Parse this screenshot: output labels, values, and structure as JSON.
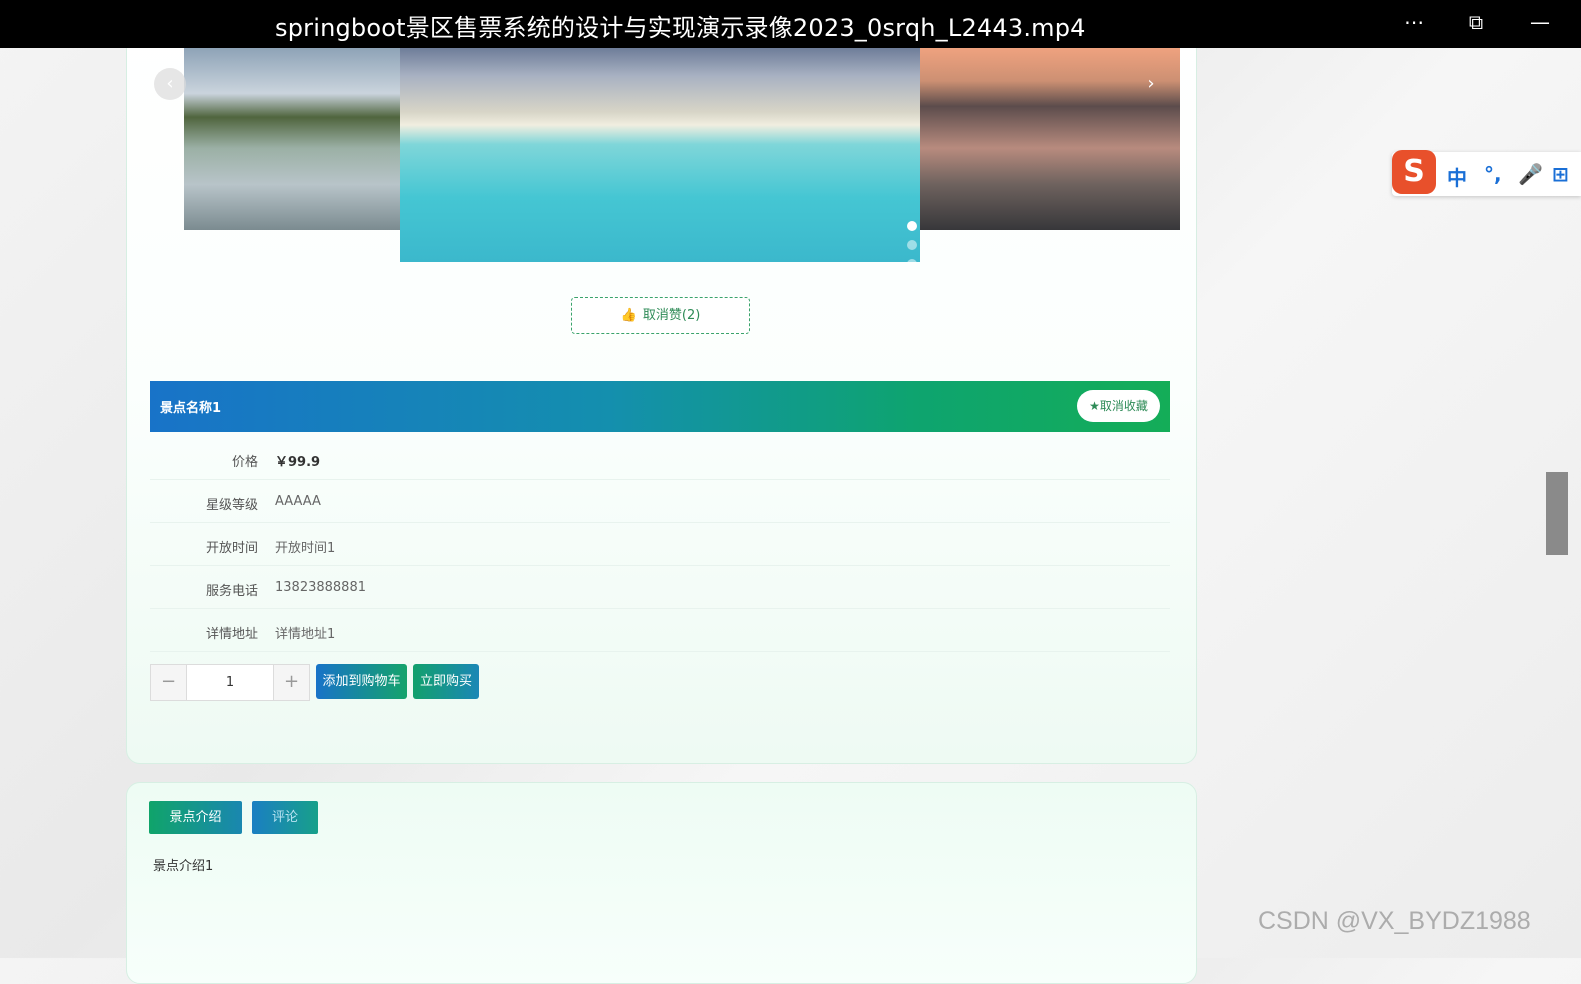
{
  "window": {
    "title": "springboot景区售票系统的设计与实现演示录像2023_0srqh_L2443.mp4",
    "more_glyph": "⋯",
    "pip_glyph": "⧉",
    "minimize_glyph": "—"
  },
  "carousel": {
    "prev_glyph": "‹",
    "next_glyph": "›",
    "dot_count": 3,
    "active_dot": 1
  },
  "like": {
    "icon": "thumbs-up-icon",
    "glyph": "👍",
    "label": "取消赞(2)"
  },
  "scenic": {
    "name": "景点名称1",
    "favorite_label": "★取消收藏",
    "details": [
      {
        "label": "价格",
        "value": "￥99.9"
      },
      {
        "label": "星级等级",
        "value": "AAAAA"
      },
      {
        "label": "开放时间",
        "value": "开放时间1"
      },
      {
        "label": "服务电话",
        "value": "13823888881"
      },
      {
        "label": "详情地址",
        "value": "详情地址1"
      }
    ]
  },
  "purchase": {
    "minus": "−",
    "quantity": "1",
    "plus": "+",
    "add_cart_label": "添加到购物车",
    "buy_now_label": "立即购买"
  },
  "tabs": [
    {
      "label": "景点介绍",
      "active": true
    },
    {
      "label": "评论",
      "active": false
    }
  ],
  "intro": {
    "text": "景点介绍1"
  },
  "ime": {
    "logo": "S",
    "mode": "中",
    "punct": "°,",
    "mic": "🎤",
    "grid": "⊞"
  },
  "watermark": "CSDN @VX_BYDZ1988",
  "colors": {
    "brand_blue": "#1873c8",
    "brand_green": "#14ad58",
    "like_green": "#2e8b57"
  }
}
